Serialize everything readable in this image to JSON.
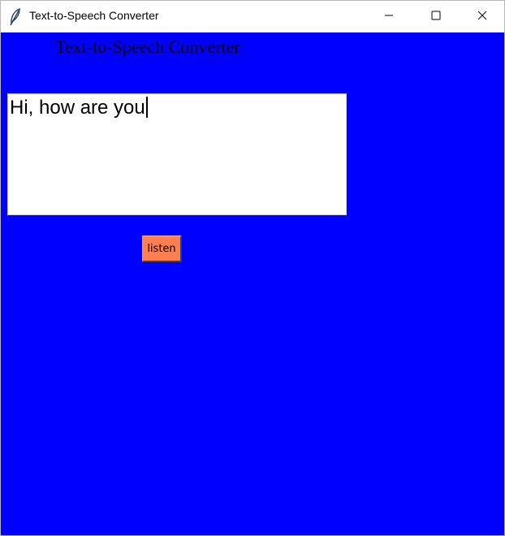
{
  "window": {
    "title": "Text-to-Speech Converter",
    "icon": "feather-icon"
  },
  "titlebar_controls": {
    "minimize_icon": "minimize-icon",
    "maximize_icon": "maximize-icon",
    "close_icon": "close-icon"
  },
  "app": {
    "heading": "Text-to-Speech Converter",
    "text_value": "Hi, how are you",
    "listen_label": "listen"
  },
  "colors": {
    "background": "#0000ff",
    "button": "#ff7f50",
    "text_area": "#ffffff"
  }
}
